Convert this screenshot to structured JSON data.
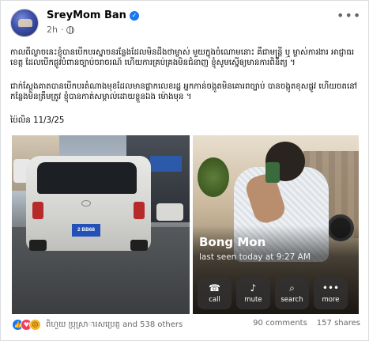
{
  "post": {
    "author": "SreyMom Ban",
    "timestamp": "2h",
    "verified_icon": "verified-badge-icon",
    "privacy_icon": "globe-icon",
    "more_label": "•••",
    "paragraphs": [
      "កាលពីល្ងាចនេះខ្ញុំបានបើកបរស្នាចនរន្លែងដែលមិនដឹងថាម្ចាស់ មួយក្នុងចំណោមនោះ គឺជាមន្ត្រី ឬ ម្ចាស់ការងារ អាជ្ញាធរខេត្ត ដែលបើកផ្លូវបំពានច្បាប់ចរាចរណ៍ ហើយការគ្រប់គ្រងមិនជំនាញ ខ្ញុំសូមស្នើឲ្យមានការពិនិត្យ ។",
      "ជាក់ស្តែងគាតបានបើកបរតំណាងមុខដែលមានផ្លាកលេខរដ្ឋ អ្នកកាន់ចង្កូតមិនគោរពច្បាប់ បានចង្កូតខុសផ្លូវ ហើយចតនៅកន្លែងមិនត្រឹមត្រូវ ខ្ញុំបានកាត់សម្គាល់ដោយខ្លួនឯង ម៉ោងមុន ។",
      "ប៉ៃលិន 11/3/25"
    ],
    "photos": {
      "left_plate": "2 BB68",
      "contact_name": "Bong Mon",
      "last_seen": "last seen today at 9:27 AM",
      "actions": [
        {
          "icon": "☎",
          "icon_name": "phone-icon",
          "label": "call"
        },
        {
          "icon": "♪",
          "icon_name": "bell-icon",
          "label": "mute"
        },
        {
          "icon": "⌕",
          "icon_name": "search-icon",
          "label": "search"
        },
        {
          "icon": "•••",
          "icon_name": "more-icon",
          "label": "more"
        }
      ]
    },
    "reactions_text": "ពិហួយ ប្រុស្រាារសប្រេត្ញ and 538 others",
    "comments": "90 comments",
    "shares": "157 shares"
  }
}
